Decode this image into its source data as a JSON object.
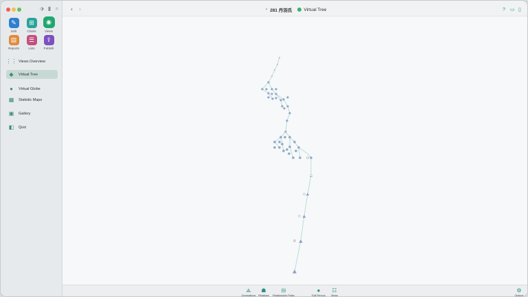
{
  "window": {
    "accent": "#2bb3a3"
  },
  "sidebar": {
    "modules": [
      {
        "label": "Edit",
        "icon": "pencil-icon",
        "color": "#2f7fd0"
      },
      {
        "label": "Charts",
        "icon": "charts-icon",
        "color": "#2aa39a"
      },
      {
        "label": "Views",
        "icon": "eye-icon",
        "color": "#1fa76f"
      },
      {
        "label": "Reports",
        "icon": "reports-icon",
        "color": "#e08a3a"
      },
      {
        "label": "Lists",
        "icon": "lists-icon",
        "color": "#c2507e"
      },
      {
        "label": "Publish",
        "icon": "publish-icon",
        "color": "#7d4fbf"
      }
    ],
    "items": [
      {
        "label": "Views Overview",
        "icon": "grid-icon"
      },
      {
        "label": "Virtual Tree",
        "icon": "tree-icon",
        "active": true
      },
      {
        "label": "Virtual Globe",
        "icon": "globe-icon"
      },
      {
        "label": "Statistic Maps",
        "icon": "map-icon"
      },
      {
        "label": "Gallery",
        "icon": "gallery-icon"
      },
      {
        "label": "Quiz",
        "icon": "quiz-icon"
      }
    ]
  },
  "header": {
    "document": "281 丹羽氏",
    "view": "Virtual Tree"
  },
  "bottombar": {
    "items": [
      {
        "label": "Generations",
        "icon": "generations-icon"
      },
      {
        "label": "Relatives",
        "icon": "relatives-icon"
      },
      {
        "label": "Relationship Paths",
        "icon": "relationship-paths-icon"
      },
      {
        "label": "Edit Person",
        "icon": "edit-person-icon"
      },
      {
        "label": "Views",
        "icon": "views-icon"
      },
      {
        "label": "Options",
        "icon": "options-icon"
      }
    ]
  }
}
